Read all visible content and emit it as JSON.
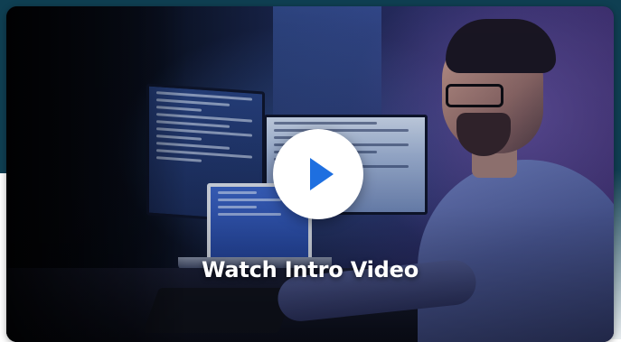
{
  "video": {
    "caption": "Watch Intro Video",
    "play_icon": "play-icon",
    "accent_color": "#1e6fe0",
    "band_color": "#0f3f52"
  }
}
